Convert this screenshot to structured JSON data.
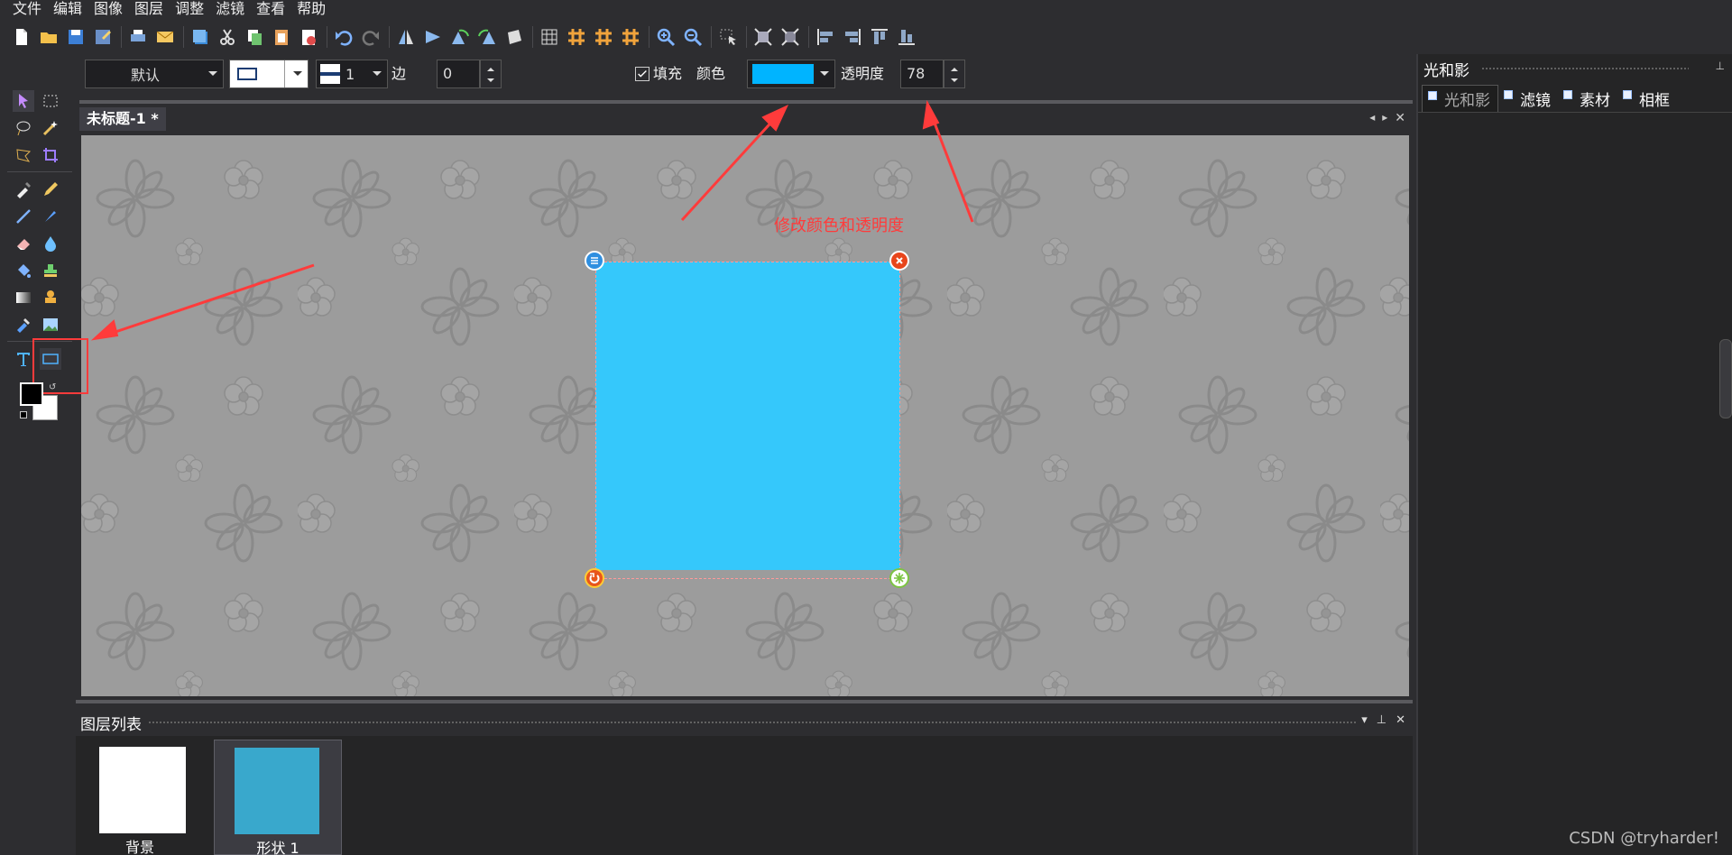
{
  "menu": [
    "文件",
    "编辑",
    "图像",
    "图层",
    "调整",
    "滤镜",
    "查看",
    "帮助"
  ],
  "toolbar_icons": [
    "new-file-icon",
    "open-folder-icon",
    "save-icon",
    "save-as-icon",
    "print-icon",
    "email-icon",
    "copy-window-icon",
    "cut-icon",
    "copy-icon",
    "paste-icon",
    "clear-icon",
    "undo-icon",
    "redo-icon",
    "flip-vertical-icon",
    "flip-horizontal-icon",
    "rotate-left-icon",
    "rotate-right-icon",
    "distort-icon",
    "grid-icon",
    "hash-icon",
    "hash-icon",
    "hash-icon",
    "zoom-in-icon",
    "zoom-out-icon",
    "pointer-select-icon",
    "fit-icon",
    "actual-size-icon",
    "align-left-icon",
    "align-right-icon",
    "align-top-icon",
    "align-bottom-icon"
  ],
  "options": {
    "preset": "默认",
    "stroke_width": "1",
    "edge_label": "边",
    "edge_value": "0",
    "fill_label": "填充",
    "color_label": "颜色",
    "fill_color": "#00b4ff",
    "opacity_label": "透明度",
    "opacity_value": "78"
  },
  "document": {
    "tab_title": "未标题-1 *"
  },
  "shape": {
    "fill_color": "#35c8fb"
  },
  "annotation": {
    "text": "修改颜色和透明度",
    "color": "#ff3b3b"
  },
  "layers": {
    "title": "图层列表",
    "items": [
      {
        "name": "背景",
        "thumb_color": "#ffffff",
        "selected": false
      },
      {
        "name": "形状 1",
        "thumb_color": "#39a8cc",
        "selected": true
      }
    ]
  },
  "right_panel": {
    "title": "光和影",
    "tabs": [
      "光和影",
      "滤镜",
      "素材",
      "相框"
    ]
  },
  "watermark": "CSDN @tryharder!"
}
